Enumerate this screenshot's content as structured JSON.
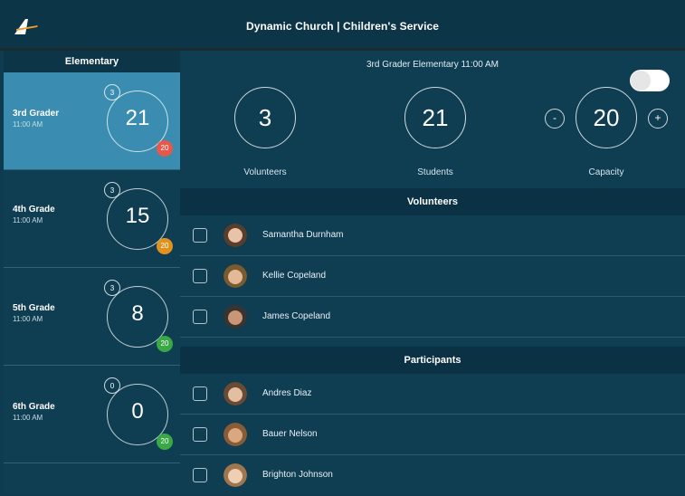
{
  "app": {
    "title": "Dynamic Church | Children's Service"
  },
  "colors": {
    "accent_selected": "#3a8db0",
    "badge_red": "#e8584a",
    "badge_orange": "#e0921e",
    "badge_green": "#39a845"
  },
  "sidebar": {
    "header": "Elementary",
    "items": [
      {
        "name": "3rd Grader",
        "time": "11:00 AM",
        "volunteers": "3",
        "students": "21",
        "capacity": "20",
        "badge_color": "#e8584a"
      },
      {
        "name": "4th Grade",
        "time": "11:00 AM",
        "volunteers": "3",
        "students": "15",
        "capacity": "20",
        "badge_color": "#e0921e"
      },
      {
        "name": "5th Grade",
        "time": "11:00 AM",
        "volunteers": "3",
        "students": "8",
        "capacity": "20",
        "badge_color": "#39a845"
      },
      {
        "name": "6th Grade",
        "time": "11:00 AM",
        "volunteers": "0",
        "students": "0",
        "capacity": "20",
        "badge_color": "#39a845"
      }
    ]
  },
  "main": {
    "title": "3rd Grader Elementary 11:00 AM",
    "stats": {
      "volunteers": {
        "value": "3",
        "label": "Volunteers"
      },
      "students": {
        "value": "21",
        "label": "Students"
      },
      "capacity": {
        "value": "20",
        "label": "Capacity",
        "minus": "-",
        "plus": "+"
      }
    },
    "volunteers_header": "Volunteers",
    "volunteers": [
      {
        "name": "Samantha Durnham"
      },
      {
        "name": "Kellie Copeland"
      },
      {
        "name": "James Copeland"
      }
    ],
    "participants_header": "Participants",
    "participants": [
      {
        "name": "Andres Diaz"
      },
      {
        "name": "Bauer Nelson"
      },
      {
        "name": "Brighton Johnson"
      }
    ]
  }
}
